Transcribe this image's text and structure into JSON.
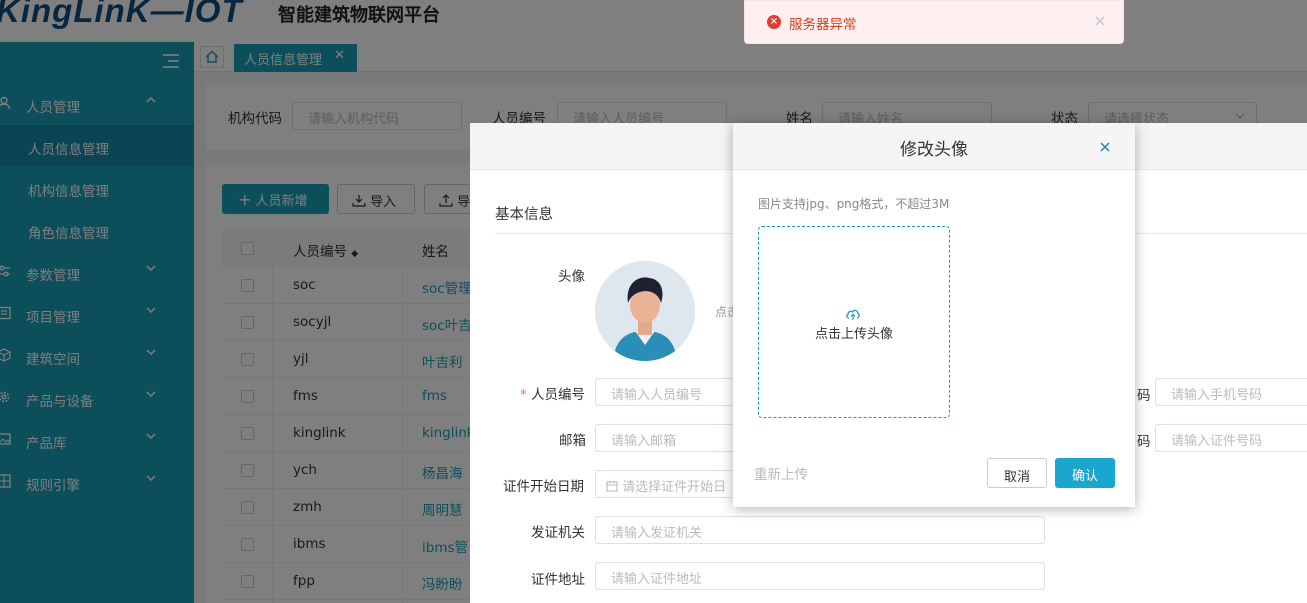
{
  "header": {
    "logo": "KingLinK—IOT",
    "subtitle": "智能建筑物联网平台"
  },
  "sidebar": {
    "items": [
      {
        "label": "人员管理",
        "icon": "user-icon",
        "expanded": true,
        "children": [
          {
            "label": "人员信息管理",
            "active": true
          },
          {
            "label": "机构信息管理"
          },
          {
            "label": "角色信息管理"
          }
        ]
      },
      {
        "label": "参数管理",
        "icon": "sliders-icon"
      },
      {
        "label": "项目管理",
        "icon": "list-icon"
      },
      {
        "label": "建筑空间",
        "icon": "cube-icon"
      },
      {
        "label": "产品与设备",
        "icon": "gear-icon"
      },
      {
        "label": "产品库",
        "icon": "image-icon"
      },
      {
        "label": "规则引擎",
        "icon": "rule-icon"
      }
    ]
  },
  "tabs": {
    "active_tab": "人员信息管理"
  },
  "filters": {
    "org_code_label": "机构代码",
    "org_code_placeholder": "请输入机构代码",
    "person_id_label": "人员编号",
    "person_id_placeholder": "请输入人员编号",
    "name_label": "姓名",
    "name_placeholder": "请输入姓名",
    "status_label": "状态",
    "status_placeholder": "请选择状态"
  },
  "toolbar": {
    "add_label": "人员新增",
    "import_label": "导入",
    "export_label": "导"
  },
  "table": {
    "columns": [
      "人员编号",
      "姓名"
    ],
    "rows": [
      {
        "id": "soc",
        "name": "soc管理"
      },
      {
        "id": "socyjl",
        "name": "soc叶吉"
      },
      {
        "id": "yjl",
        "name": "叶吉利"
      },
      {
        "id": "fms",
        "name": "fms"
      },
      {
        "id": "kinglink",
        "name": "kinglink"
      },
      {
        "id": "ych",
        "name": "杨昌海"
      },
      {
        "id": "zmh",
        "name": "周明慧"
      },
      {
        "id": "ibms",
        "name": "ibms管"
      },
      {
        "id": "fpp",
        "name": "冯盼盼"
      }
    ]
  },
  "edit_form": {
    "section_title": "基本信息",
    "avatar_label": "头像",
    "avatar_hint": "点击",
    "person_id_label": "人员编号",
    "person_id_placeholder": "请输入人员编号",
    "email_label": "邮箱",
    "email_placeholder": "请输入邮箱",
    "cert_start_label": "证件开始日期",
    "cert_start_placeholder": "请选择证件开始日",
    "issuer_label": "发证机关",
    "issuer_placeholder": "请输入发证机关",
    "cert_addr_label": "证件地址",
    "cert_addr_placeholder": "请输入证件地址",
    "phone_label_tail": "码",
    "phone_placeholder": "请输入手机号码",
    "cert_no_label_tail": "码",
    "cert_no_placeholder": "请输入证件号码"
  },
  "modal": {
    "title": "修改头像",
    "hint": "图片支持jpg、png格式，不超过3M",
    "upload_label": "点击上传头像",
    "reupload_label": "重新上传",
    "cancel_label": "取消",
    "confirm_label": "确认"
  },
  "toast": {
    "message": "服务器异常",
    "type": "error"
  },
  "colors": {
    "primary": "#1a9cb6",
    "confirm": "#1aa6cf",
    "error": "#e03c2b",
    "logo": "#0e4f82"
  }
}
